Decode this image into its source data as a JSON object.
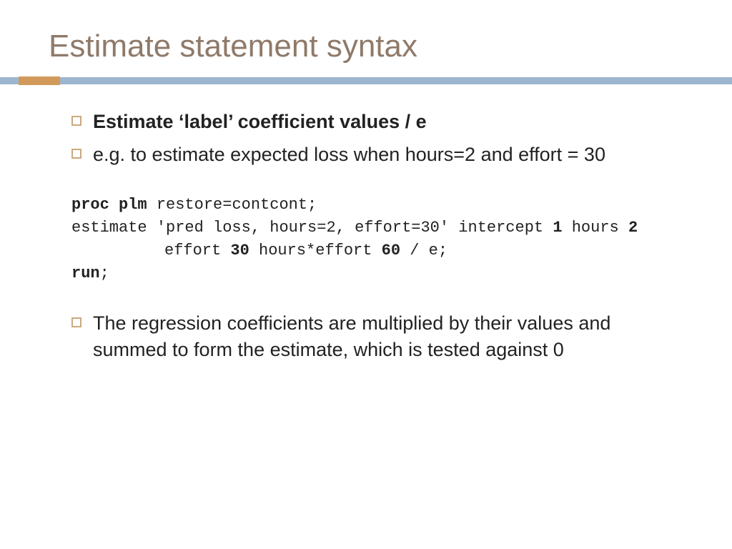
{
  "title": "Estimate statement syntax",
  "bullets": {
    "b1": "Estimate ‘label’ coefficient values / e",
    "b2": "e.g. to estimate expected loss when hours=2 and effort = 30",
    "b3": "The regression coefficients are multiplied by their values and summed to form the estimate, which is tested against 0"
  },
  "code": {
    "l1a": "proc plm",
    "l1b": " restore=contcont;",
    "l2a": "estimate 'pred loss, hours=2, effort=30' intercept ",
    "l2b": "1",
    "l2c": " hours ",
    "l2d": "2",
    "l2e": "effort ",
    "l2f": "30",
    "l2g": " hours*effort ",
    "l2h": "60",
    "l2i": " / e;",
    "l3a": "run",
    "l3b": ";"
  }
}
